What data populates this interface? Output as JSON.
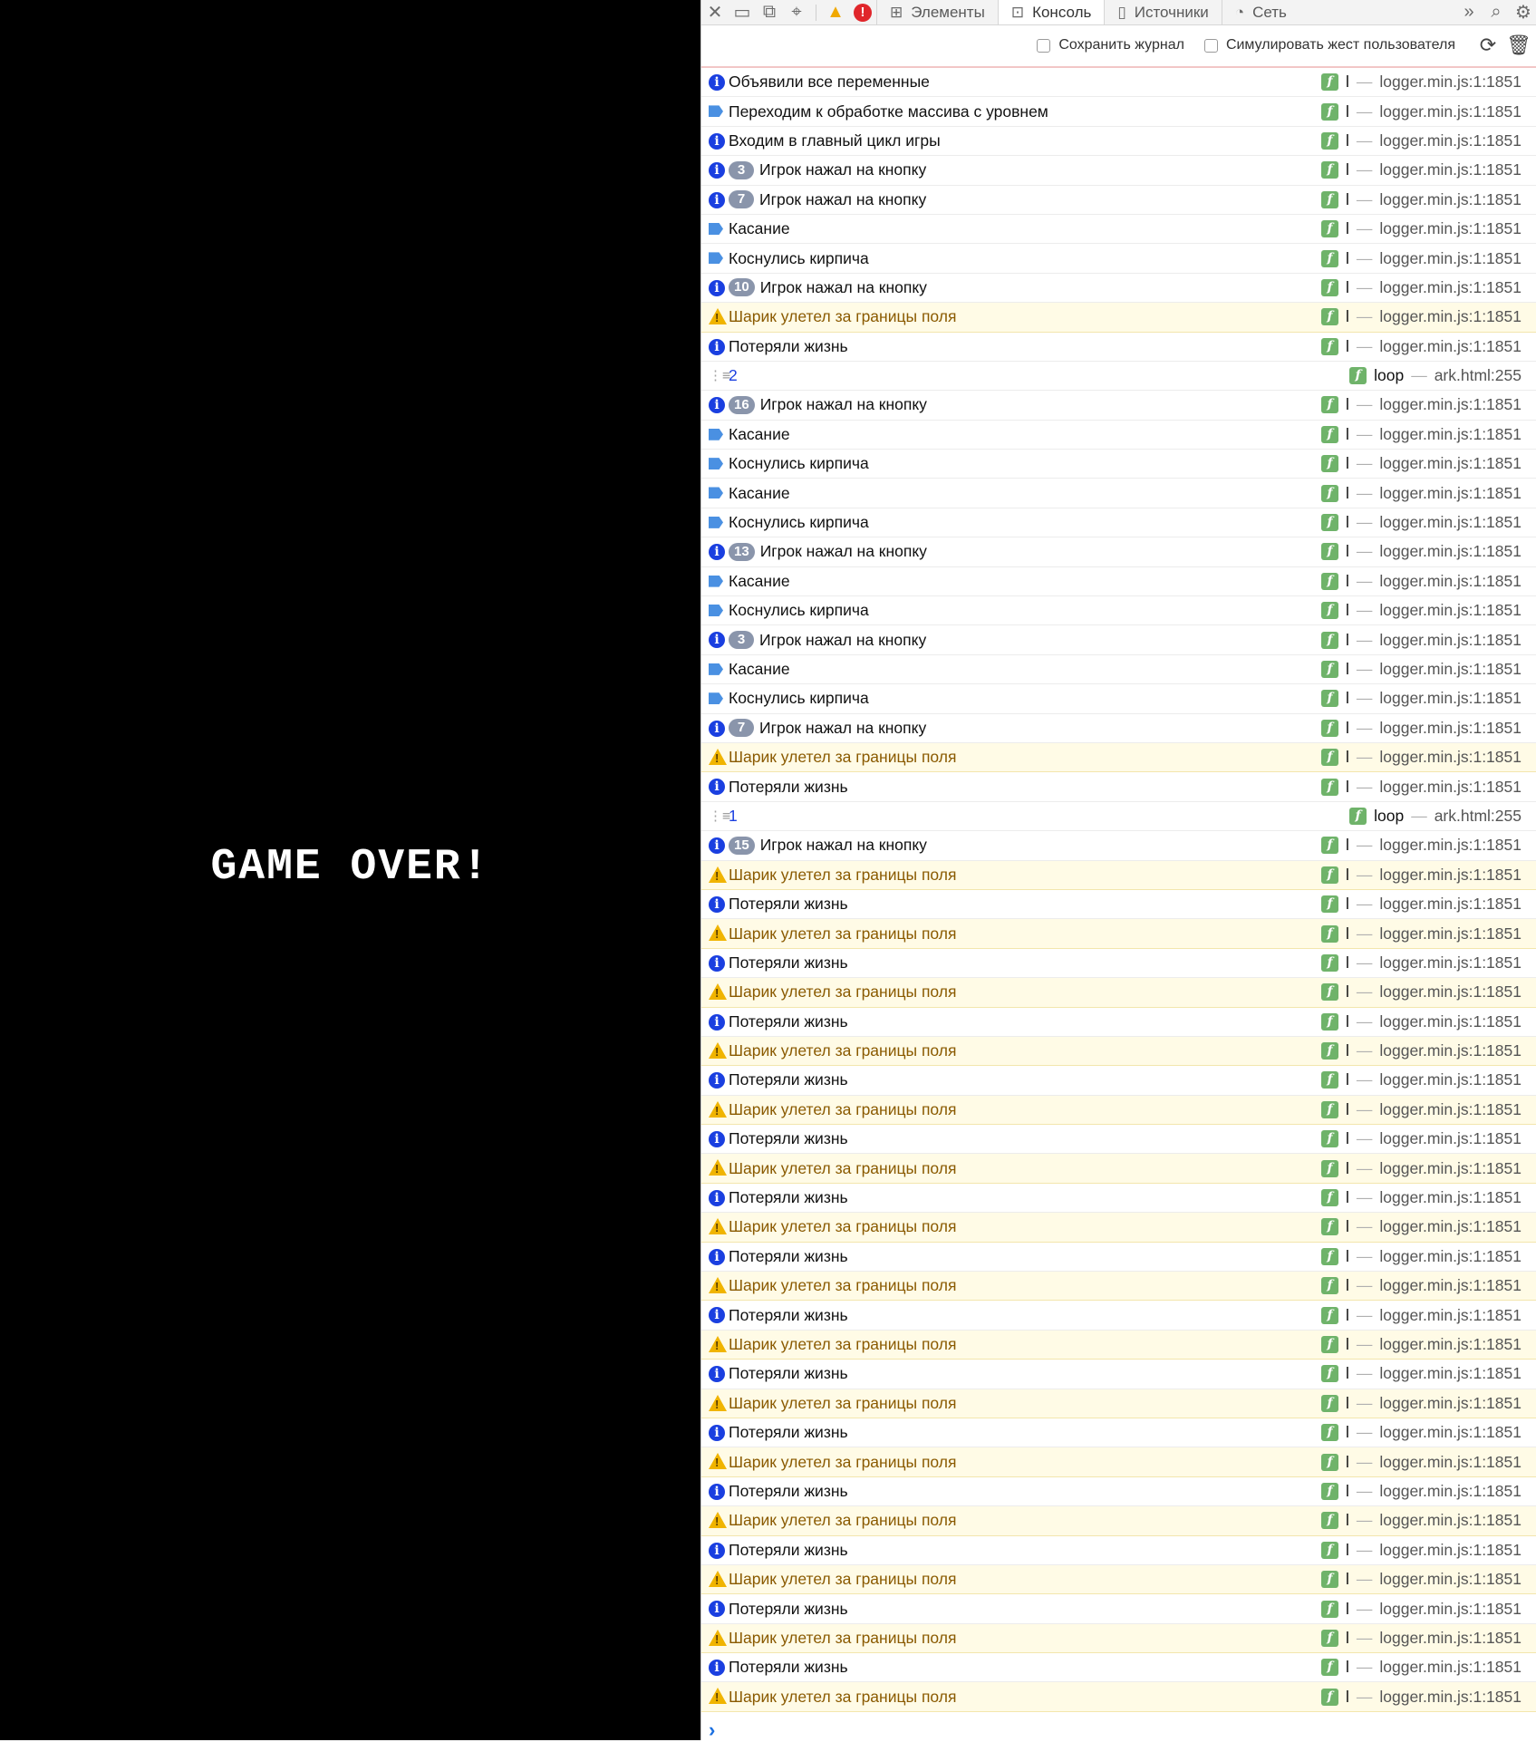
{
  "game": {
    "message": "GAME OVER!"
  },
  "devtools": {
    "tabs": [
      {
        "label": "Элементы",
        "icon": "elements-icon"
      },
      {
        "label": "Консоль",
        "icon": "console-icon",
        "active": true
      },
      {
        "label": "Источники",
        "icon": "sources-icon"
      },
      {
        "label": "Сеть",
        "icon": "network-icon"
      }
    ],
    "toolbar": {
      "preserve_log": "Сохранить журнал",
      "emulate_gesture": "Симулировать жест пользователя"
    },
    "colors": {
      "info": "#1a3fe0",
      "debug": "#4a90e2",
      "warn": "#f0b400",
      "warn_bg": "#fffbe6",
      "func_badge": "#6fb36a"
    }
  },
  "console": {
    "default_source": {
      "fn": "l",
      "file": "logger.min.js:1:1851"
    },
    "group_source": {
      "fn": "loop",
      "file": "ark.html:255"
    },
    "rows": [
      {
        "type": "info",
        "text": "Объявили все переменные"
      },
      {
        "type": "debug",
        "text": "Переходим к обработке массива с уровнем"
      },
      {
        "type": "info",
        "text": "Входим в главный цикл игры"
      },
      {
        "type": "info",
        "count": "3",
        "text": "Игрок нажал на кнопку"
      },
      {
        "type": "info",
        "count": "7",
        "text": "Игрок нажал на кнопку"
      },
      {
        "type": "debug",
        "text": "Касание"
      },
      {
        "type": "debug",
        "text": "Коснулись кирпича"
      },
      {
        "type": "info",
        "count": "10",
        "text": "Игрок нажал на кнопку"
      },
      {
        "type": "warn",
        "text": "Шарик улетел за границы поля"
      },
      {
        "type": "info",
        "text": "Потеряли жизнь"
      },
      {
        "type": "group",
        "text": "2"
      },
      {
        "type": "info",
        "count": "16",
        "text": "Игрок нажал на кнопку"
      },
      {
        "type": "debug",
        "text": "Касание"
      },
      {
        "type": "debug",
        "text": "Коснулись кирпича"
      },
      {
        "type": "debug",
        "text": "Касание"
      },
      {
        "type": "debug",
        "text": "Коснулись кирпича"
      },
      {
        "type": "info",
        "count": "13",
        "text": "Игрок нажал на кнопку"
      },
      {
        "type": "debug",
        "text": "Касание"
      },
      {
        "type": "debug",
        "text": "Коснулись кирпича"
      },
      {
        "type": "info",
        "count": "3",
        "text": "Игрок нажал на кнопку"
      },
      {
        "type": "debug",
        "text": "Касание"
      },
      {
        "type": "debug",
        "text": "Коснулись кирпича"
      },
      {
        "type": "info",
        "count": "7",
        "text": "Игрок нажал на кнопку"
      },
      {
        "type": "warn",
        "text": "Шарик улетел за границы поля"
      },
      {
        "type": "info",
        "text": "Потеряли жизнь"
      },
      {
        "type": "group",
        "text": "1"
      },
      {
        "type": "info",
        "count": "15",
        "text": "Игрок нажал на кнопку"
      },
      {
        "type": "warn",
        "text": "Шарик улетел за границы поля"
      },
      {
        "type": "info",
        "text": "Потеряли жизнь"
      },
      {
        "type": "warn",
        "text": "Шарик улетел за границы поля"
      },
      {
        "type": "info",
        "text": "Потеряли жизнь"
      },
      {
        "type": "warn",
        "text": "Шарик улетел за границы поля"
      },
      {
        "type": "info",
        "text": "Потеряли жизнь"
      },
      {
        "type": "warn",
        "text": "Шарик улетел за границы поля"
      },
      {
        "type": "info",
        "text": "Потеряли жизнь"
      },
      {
        "type": "warn",
        "text": "Шарик улетел за границы поля"
      },
      {
        "type": "info",
        "text": "Потеряли жизнь"
      },
      {
        "type": "warn",
        "text": "Шарик улетел за границы поля"
      },
      {
        "type": "info",
        "text": "Потеряли жизнь"
      },
      {
        "type": "warn",
        "text": "Шарик улетел за границы поля"
      },
      {
        "type": "info",
        "text": "Потеряли жизнь"
      },
      {
        "type": "warn",
        "text": "Шарик улетел за границы поля"
      },
      {
        "type": "info",
        "text": "Потеряли жизнь"
      },
      {
        "type": "warn",
        "text": "Шарик улетел за границы поля"
      },
      {
        "type": "info",
        "text": "Потеряли жизнь"
      },
      {
        "type": "warn",
        "text": "Шарик улетел за границы поля"
      },
      {
        "type": "info",
        "text": "Потеряли жизнь"
      },
      {
        "type": "warn",
        "text": "Шарик улетел за границы поля"
      },
      {
        "type": "info",
        "text": "Потеряли жизнь"
      },
      {
        "type": "warn",
        "text": "Шарик улетел за границы поля"
      },
      {
        "type": "info",
        "text": "Потеряли жизнь"
      },
      {
        "type": "warn",
        "text": "Шарик улетел за границы поля"
      },
      {
        "type": "info",
        "text": "Потеряли жизнь"
      },
      {
        "type": "warn",
        "text": "Шарик улетел за границы поля"
      },
      {
        "type": "info",
        "text": "Потеряли жизнь"
      },
      {
        "type": "warn",
        "text": "Шарик улетел за границы поля"
      }
    ]
  }
}
